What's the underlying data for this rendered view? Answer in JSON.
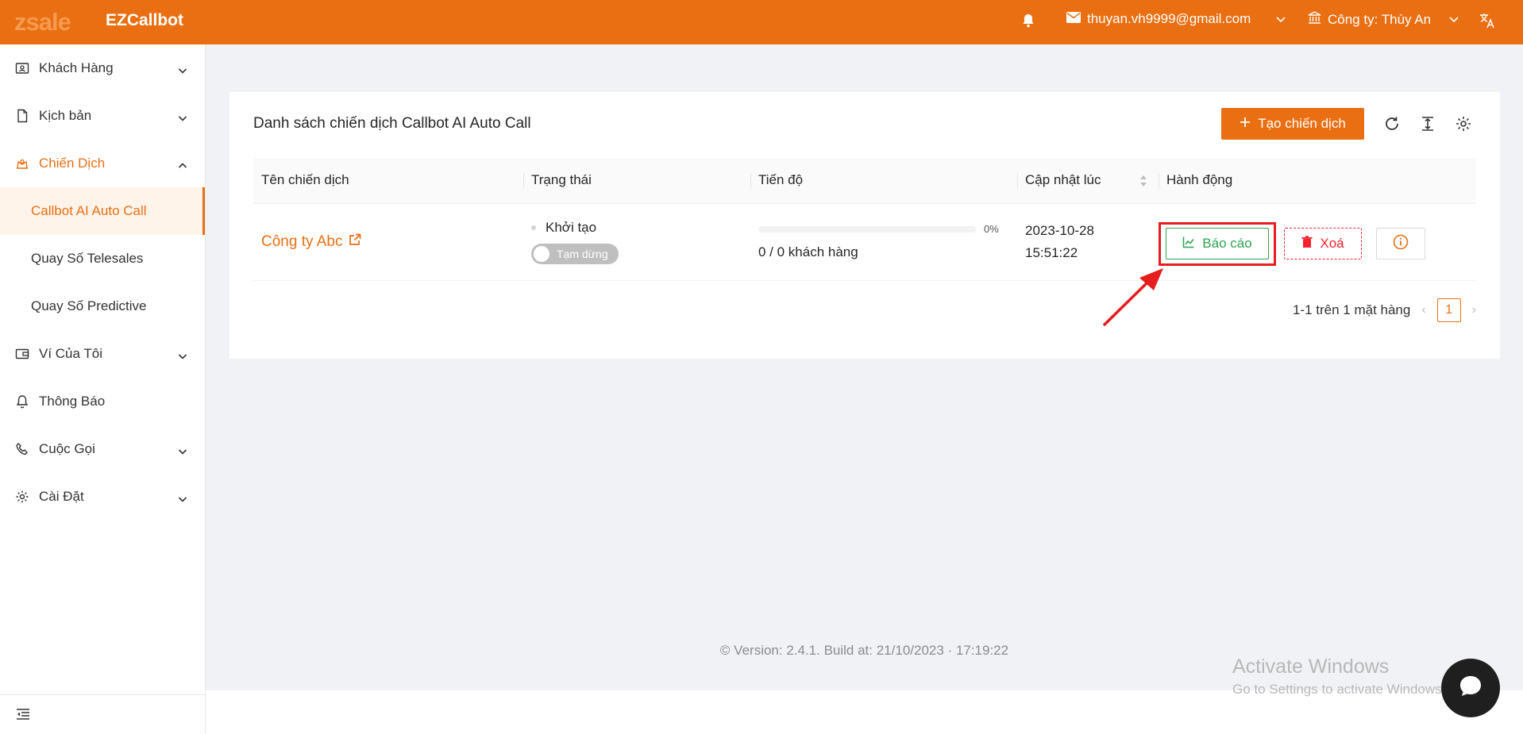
{
  "header": {
    "logo_text": "zsale",
    "app_name": "EZCallbot",
    "email": "thuyan.vh9999@gmail.com",
    "company": "Công ty: Thùy An"
  },
  "sidebar": {
    "items": [
      {
        "label": "Khách Hàng",
        "icon": "contacts-icon",
        "expandable": true
      },
      {
        "label": "Kịch bản",
        "icon": "document-icon",
        "expandable": true
      },
      {
        "label": "Chiến Dịch",
        "icon": "campaign-icon",
        "expandable": true,
        "expanded": true
      },
      {
        "label": "Ví Của Tôi",
        "icon": "wallet-icon",
        "expandable": true
      },
      {
        "label": "Thông Báo",
        "icon": "bell-icon",
        "expandable": false
      },
      {
        "label": "Cuộc Gọi",
        "icon": "phone-icon",
        "expandable": true
      },
      {
        "label": "Cài Đặt",
        "icon": "gear-icon",
        "expandable": true
      }
    ],
    "subitems": [
      {
        "label": "Callbot AI Auto Call",
        "selected": true
      },
      {
        "label": "Quay Số Telesales"
      },
      {
        "label": "Quay Số Predictive"
      }
    ]
  },
  "main": {
    "title": "Danh sách chiến dịch Callbot AI Auto Call",
    "create_button": "Tạo chiến dịch",
    "columns": [
      "Tên chiến dịch",
      "Trạng thái",
      "Tiến độ",
      "Cập nhật lúc",
      "Hành động"
    ],
    "rows": [
      {
        "name": "Công ty Abc",
        "status": "Khởi tạo",
        "toggle_label": "Tạm dừng",
        "progress_percent": 0,
        "progress_label": "0%",
        "progress_text": "0 / 0 khách hàng",
        "updated_date": "2023-10-28",
        "updated_time": "15:51:22"
      }
    ],
    "actions": {
      "report": "Báo cáo",
      "delete": "Xoá"
    },
    "pagination": {
      "summary": "1-1 trên 1 mặt hàng",
      "current_page": "1"
    }
  },
  "footer": {
    "version": "Version: 2.4.1. Build at: 21/10/2023 · 17:19:22"
  },
  "watermark": {
    "line1": "Activate Windows",
    "line2": "Go to Settings to activate Windows."
  },
  "colors": {
    "brand": "#e96f12",
    "success": "#2ea44f",
    "danger": "#f5222d",
    "highlight": "#e51d1d"
  }
}
